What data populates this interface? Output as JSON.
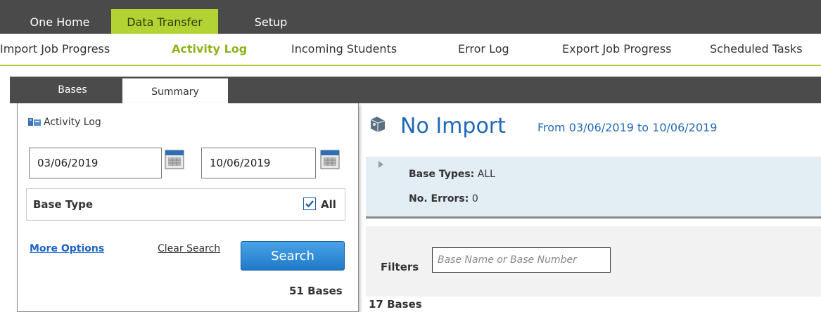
{
  "topnav": {
    "tabs": [
      {
        "label": "One Home"
      },
      {
        "label": "Data Transfer"
      },
      {
        "label": "Setup"
      }
    ]
  },
  "subnav": {
    "items": [
      {
        "label": "Import Job Progress"
      },
      {
        "label": "Activity Log"
      },
      {
        "label": "Incoming Students"
      },
      {
        "label": "Error Log"
      },
      {
        "label": "Export Job Progress"
      },
      {
        "label": "Scheduled Tasks"
      }
    ]
  },
  "tabs": [
    {
      "label": "Bases"
    },
    {
      "label": "Summary"
    }
  ],
  "leftpanel": {
    "title": "Activity Log",
    "date_from": "03/06/2019",
    "date_to": "10/06/2019",
    "base_type_label": "Base Type",
    "all_label": "All",
    "all_checked": true,
    "more_options": "More Options",
    "clear_search": "Clear Search",
    "search_button": "Search",
    "bases_count": "51 Bases"
  },
  "main": {
    "title": "No Import",
    "range": "From 03/06/2019 to 10/06/2019",
    "base_types_label": "Base Types:",
    "base_types_value": "ALL",
    "errors_label": "No. Errors:",
    "errors_value": "0",
    "filters_label": "Filters",
    "filter_placeholder": "Base Name or Base Number",
    "bases_count": "17 Bases"
  },
  "colors": {
    "accent": "#b3d334",
    "nav_bg": "#4a4a4a",
    "link": "#1d63c6",
    "title": "#1f67b8"
  }
}
